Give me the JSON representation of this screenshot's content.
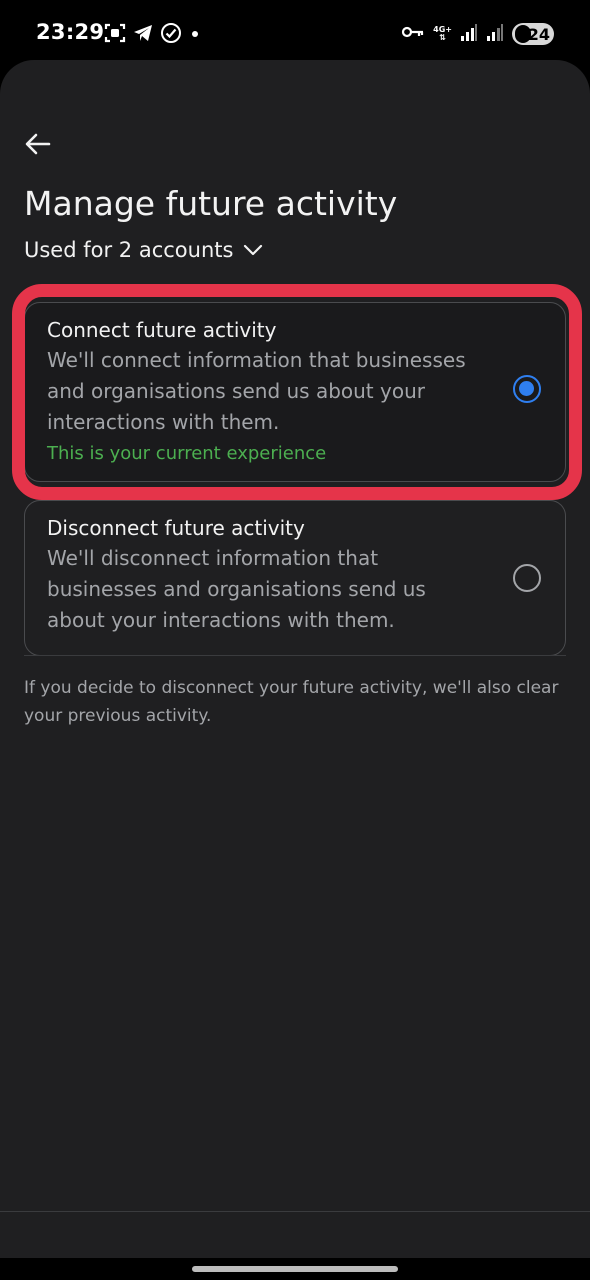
{
  "status_bar": {
    "time": "23:29",
    "network": "4G+",
    "battery": "24",
    "left_icons": [
      "screenshot-icon",
      "telegram-icon",
      "check-circle-icon",
      "dot-icon"
    ],
    "right_icons": [
      "vpn-key-icon",
      "signal-icon",
      "signal-icon",
      "battery-icon"
    ]
  },
  "header": {
    "back_icon": "arrow-left-icon",
    "title": "Manage future activity"
  },
  "accounts_selector": {
    "label": "Used for 2 accounts",
    "icon": "chevron-down-icon"
  },
  "options": [
    {
      "title": "Connect future activity",
      "description": "We'll connect information that businesses and organisations send us about your interactions with them.",
      "status": "This is your current experience",
      "selected": true
    },
    {
      "title": "Disconnect future activity",
      "description": "We'll disconnect information that businesses and organisations send us about your interactions with them.",
      "selected": false
    }
  ],
  "footnote": "If you decide to disconnect your future activity, we'll also clear your previous activity.",
  "colors": {
    "background": "#1f1f21",
    "accent": "#2f7ff0",
    "status_green": "#4caf50",
    "highlight": "#e5344a"
  }
}
